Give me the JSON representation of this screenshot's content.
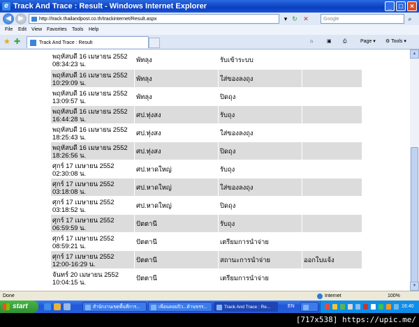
{
  "window": {
    "title": "Track And Trace : Result - Windows Internet Explorer"
  },
  "address_bar": {
    "url": "http://track.thailandpost.co.th/trackinternet/Result.aspx"
  },
  "search": {
    "placeholder": "Google"
  },
  "menu": [
    "File",
    "Edit",
    "View",
    "Favorites",
    "Tools",
    "Help"
  ],
  "tab": {
    "title": "Track And Trace : Result"
  },
  "commands": {
    "page": "Page",
    "tools": "Tools"
  },
  "table": {
    "rows": [
      [
        "พฤหัสบดี 16 เมษายน 2552 08:34:23 น.",
        "พัทลุง",
        "รับเข้าระบบ",
        ""
      ],
      [
        "พฤหัสบดี 16 เมษายน 2552 10:29:09 น.",
        "พัทลุง",
        "ใส่ของลงถุง",
        ""
      ],
      [
        "พฤหัสบดี 16 เมษายน 2552 13:09:57 น.",
        "พัทลุง",
        "ปิดถุง",
        ""
      ],
      [
        "พฤหัสบดี 16 เมษายน 2552 16:44:28 น.",
        "ศป.ทุ่งสง",
        "รับถุง",
        ""
      ],
      [
        "พฤหัสบดี 16 เมษายน 2552 18:25:43 น.",
        "ศป.ทุ่งสง",
        "ใส่ของลงถุง",
        ""
      ],
      [
        "พฤหัสบดี 16 เมษายน 2552 18:26:56 น.",
        "ศป.ทุ่งสง",
        "ปิดถุง",
        ""
      ],
      [
        "ศุกร์ 17 เมษายน 2552 02:30:08 น.",
        "ศป.หาดใหญ่",
        "รับถุง",
        ""
      ],
      [
        "ศุกร์ 17 เมษายน 2552 03:18:08 น.",
        "ศป.หาดใหญ่",
        "ใส่ของลงถุง",
        ""
      ],
      [
        "ศุกร์ 17 เมษายน 2552 03:18:52 น.",
        "ศป.หาดใหญ่",
        "ปิดถุง",
        ""
      ],
      [
        "ศุกร์ 17 เมษายน 2552 06:59:59 น.",
        "ปัตตานี",
        "รับถุง",
        ""
      ],
      [
        "ศุกร์ 17 เมษายน 2552 08:59:21 น.",
        "ปัตตานี",
        "เตรียมการนำจ่าย",
        ""
      ],
      [
        "ศุกร์ 17 เมษายน 2552 12:00-16:29 น.",
        "ปัตตานี",
        "สถานะการนำจ่าย",
        "ออกใบแจ้ง"
      ],
      [
        "จันทร์ 20 เมษายน 2552 10:04:15 น.",
        "ปัตตานี",
        "เตรียมการนำจ่าย",
        ""
      ]
    ]
  },
  "status": {
    "left": "Done",
    "zone": "Internet",
    "zoom": "100%"
  },
  "taskbar": {
    "start": "start",
    "items": [
      "สำนักงานเขตพื้นที่การ...",
      "เพื่อนคอมปิว...ด้านขรร...",
      "Track And Trace : Re...",
      ""
    ],
    "lang": "EN",
    "clock": "16:40"
  },
  "watermark": "[717x538] https://upic.me/"
}
